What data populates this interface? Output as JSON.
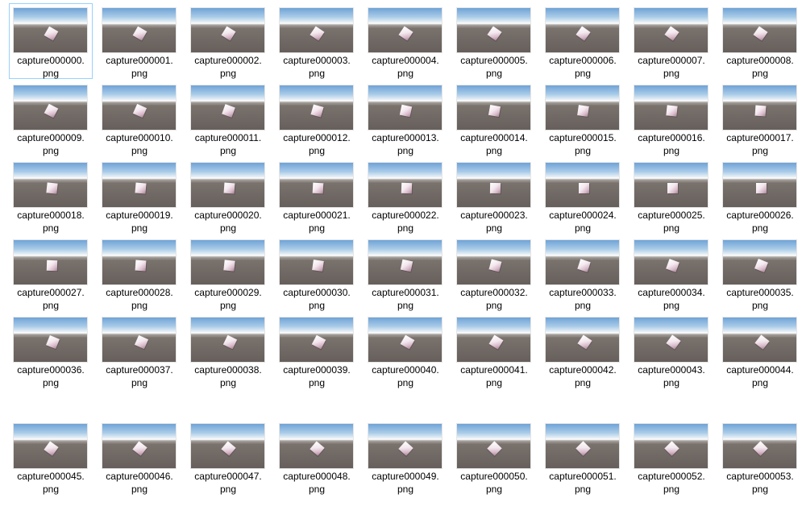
{
  "explorer": {
    "selected_index": 0,
    "files": [
      {
        "name_line1": "capture000000.",
        "name_line2": "png",
        "cube_angle": 30
      },
      {
        "name_line1": "capture000001.",
        "name_line2": "png",
        "cube_angle": 30
      },
      {
        "name_line1": "capture000002.",
        "name_line2": "png",
        "cube_angle": 32
      },
      {
        "name_line1": "capture000003.",
        "name_line2": "png",
        "cube_angle": 34
      },
      {
        "name_line1": "capture000004.",
        "name_line2": "png",
        "cube_angle": 34
      },
      {
        "name_line1": "capture000005.",
        "name_line2": "png",
        "cube_angle": 35
      },
      {
        "name_line1": "capture000006.",
        "name_line2": "png",
        "cube_angle": 36
      },
      {
        "name_line1": "capture000007.",
        "name_line2": "png",
        "cube_angle": 36
      },
      {
        "name_line1": "capture000008.",
        "name_line2": "png",
        "cube_angle": 35
      },
      {
        "name_line1": "capture000009.",
        "name_line2": "png",
        "cube_angle": 28
      },
      {
        "name_line1": "capture000010.",
        "name_line2": "png",
        "cube_angle": 24
      },
      {
        "name_line1": "capture000011.",
        "name_line2": "png",
        "cube_angle": 20
      },
      {
        "name_line1": "capture000012.",
        "name_line2": "png",
        "cube_angle": 16
      },
      {
        "name_line1": "capture000013.",
        "name_line2": "png",
        "cube_angle": 12
      },
      {
        "name_line1": "capture000014.",
        "name_line2": "png",
        "cube_angle": 10
      },
      {
        "name_line1": "capture000015.",
        "name_line2": "png",
        "cube_angle": 8
      },
      {
        "name_line1": "capture000016.",
        "name_line2": "png",
        "cube_angle": 6
      },
      {
        "name_line1": "capture000017.",
        "name_line2": "png",
        "cube_angle": 4
      },
      {
        "name_line1": "capture000018.",
        "name_line2": "png",
        "cube_angle": 6
      },
      {
        "name_line1": "capture000019.",
        "name_line2": "png",
        "cube_angle": 5
      },
      {
        "name_line1": "capture000020.",
        "name_line2": "png",
        "cube_angle": 4
      },
      {
        "name_line1": "capture000021.",
        "name_line2": "png",
        "cube_angle": 3
      },
      {
        "name_line1": "capture000022.",
        "name_line2": "png",
        "cube_angle": 2
      },
      {
        "name_line1": "capture000023.",
        "name_line2": "png",
        "cube_angle": 1
      },
      {
        "name_line1": "capture000024.",
        "name_line2": "png",
        "cube_angle": 0
      },
      {
        "name_line1": "capture000025.",
        "name_line2": "png",
        "cube_angle": 0
      },
      {
        "name_line1": "capture000026.",
        "name_line2": "png",
        "cube_angle": 0
      },
      {
        "name_line1": "capture000027.",
        "name_line2": "png",
        "cube_angle": 2
      },
      {
        "name_line1": "capture000028.",
        "name_line2": "png",
        "cube_angle": 4
      },
      {
        "name_line1": "capture000029.",
        "name_line2": "png",
        "cube_angle": 6
      },
      {
        "name_line1": "capture000030.",
        "name_line2": "png",
        "cube_angle": 8
      },
      {
        "name_line1": "capture000031.",
        "name_line2": "png",
        "cube_angle": 12
      },
      {
        "name_line1": "capture000032.",
        "name_line2": "png",
        "cube_angle": 15
      },
      {
        "name_line1": "capture000033.",
        "name_line2": "png",
        "cube_angle": 18
      },
      {
        "name_line1": "capture000034.",
        "name_line2": "png",
        "cube_angle": 20
      },
      {
        "name_line1": "capture000035.",
        "name_line2": "png",
        "cube_angle": 22
      },
      {
        "name_line1": "capture000036.",
        "name_line2": "png",
        "cube_angle": 22
      },
      {
        "name_line1": "capture000037.",
        "name_line2": "png",
        "cube_angle": 24
      },
      {
        "name_line1": "capture000038.",
        "name_line2": "png",
        "cube_angle": 26
      },
      {
        "name_line1": "capture000039.",
        "name_line2": "png",
        "cube_angle": 28
      },
      {
        "name_line1": "capture000040.",
        "name_line2": "png",
        "cube_angle": 30
      },
      {
        "name_line1": "capture000041.",
        "name_line2": "png",
        "cube_angle": 32
      },
      {
        "name_line1": "capture000042.",
        "name_line2": "png",
        "cube_angle": 34
      },
      {
        "name_line1": "capture000043.",
        "name_line2": "png",
        "cube_angle": 36
      },
      {
        "name_line1": "capture000044.",
        "name_line2": "png",
        "cube_angle": 38
      },
      {
        "name_line1": "capture000045.",
        "name_line2": "png",
        "cube_angle": 36
      },
      {
        "name_line1": "capture000046.",
        "name_line2": "png",
        "cube_angle": 38
      },
      {
        "name_line1": "capture000047.",
        "name_line2": "png",
        "cube_angle": 40
      },
      {
        "name_line1": "capture000048.",
        "name_line2": "png",
        "cube_angle": 40
      },
      {
        "name_line1": "capture000049.",
        "name_line2": "png",
        "cube_angle": 42
      },
      {
        "name_line1": "capture000050.",
        "name_line2": "png",
        "cube_angle": 44
      },
      {
        "name_line1": "capture000051.",
        "name_line2": "png",
        "cube_angle": 45
      },
      {
        "name_line1": "capture000052.",
        "name_line2": "png",
        "cube_angle": 45
      },
      {
        "name_line1": "capture000053.",
        "name_line2": "png",
        "cube_angle": 45
      }
    ]
  }
}
